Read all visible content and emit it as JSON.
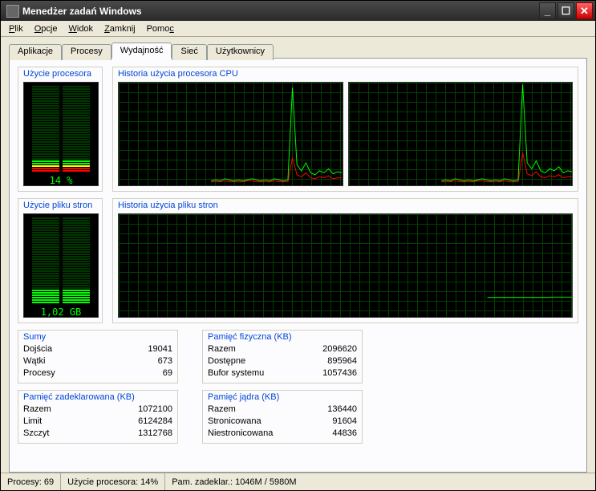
{
  "window": {
    "title": "Menedżer zadań Windows"
  },
  "menu": [
    "Plik",
    "Opcje",
    "Widok",
    "Zamknij",
    "Pomoc"
  ],
  "tabs": [
    {
      "label": "Aplikacje",
      "active": false
    },
    {
      "label": "Procesy",
      "active": false
    },
    {
      "label": "Wydajność",
      "active": true
    },
    {
      "label": "Sieć",
      "active": false
    },
    {
      "label": "Użytkownicy",
      "active": false
    }
  ],
  "cpu_gauge": {
    "title": "Użycie procesora",
    "value": "14 %"
  },
  "cpu_history": {
    "title": "Historia użycia procesora CPU"
  },
  "pf_gauge": {
    "title": "Użycie pliku stron",
    "value": "1,02 GB"
  },
  "pf_history": {
    "title": "Historia użycia pliku stron"
  },
  "stats": {
    "totals": {
      "title": "Sumy",
      "rows": [
        {
          "k": "Dojścia",
          "v": "19041"
        },
        {
          "k": "Wątki",
          "v": "673"
        },
        {
          "k": "Procesy",
          "v": "69"
        }
      ]
    },
    "phys": {
      "title": "Pamięć fizyczna (KB)",
      "rows": [
        {
          "k": "Razem",
          "v": "2096620"
        },
        {
          "k": "Dostępne",
          "v": "895964"
        },
        {
          "k": "Bufor systemu",
          "v": "1057436"
        }
      ]
    },
    "commit": {
      "title": "Pamięć zadeklarowana (KB)",
      "rows": [
        {
          "k": "Razem",
          "v": "1072100"
        },
        {
          "k": "Limit",
          "v": "6124284"
        },
        {
          "k": "Szczyt",
          "v": "1312768"
        }
      ]
    },
    "kernel": {
      "title": "Pamięć jądra (KB)",
      "rows": [
        {
          "k": "Razem",
          "v": "136440"
        },
        {
          "k": "Stronicowana",
          "v": "91604"
        },
        {
          "k": "Niestronicowana",
          "v": "44836"
        }
      ]
    }
  },
  "status": {
    "processes": "Procesy: 69",
    "cpu": "Użycie procesora: 14%",
    "commit": "Pam. zadeklar.: 1046M / 5980M"
  },
  "chart_data": [
    {
      "type": "bar",
      "name": "cpu_gauge",
      "title": "Użycie procesora",
      "values": [
        14
      ],
      "ylim": [
        0,
        100
      ],
      "ylabel": "%",
      "label": "14 %"
    },
    {
      "type": "bar",
      "name": "pagefile_gauge",
      "title": "Użycie pliku stron",
      "values": [
        1.02
      ],
      "ylim": [
        0,
        6
      ],
      "ylabel": "GB",
      "label": "1,02 GB"
    },
    {
      "type": "line",
      "name": "cpu_history",
      "title": "Historia użycia procesora CPU",
      "panels": 2,
      "ylim": [
        0,
        100
      ],
      "xlabel": "time",
      "ylabel": "CPU %",
      "series": [
        {
          "name": "CPU0-user",
          "color": "#00ff00",
          "values": [
            2,
            3,
            2,
            4,
            3,
            2,
            3,
            2,
            3,
            4,
            3,
            2,
            3,
            2,
            4,
            3,
            2,
            3,
            95,
            18,
            12,
            20,
            10,
            8,
            12,
            10,
            14,
            9,
            11,
            10
          ]
        },
        {
          "name": "CPU0-kernel",
          "color": "#ff0000",
          "values": [
            1,
            1,
            1,
            2,
            1,
            1,
            1,
            1,
            2,
            2,
            1,
            1,
            1,
            1,
            2,
            1,
            1,
            1,
            25,
            8,
            6,
            10,
            5,
            4,
            6,
            5,
            7,
            4,
            5,
            5
          ]
        },
        {
          "name": "CPU1-user",
          "color": "#00ff00",
          "values": [
            2,
            3,
            2,
            4,
            3,
            2,
            3,
            2,
            3,
            4,
            3,
            2,
            3,
            2,
            4,
            3,
            2,
            3,
            98,
            20,
            14,
            22,
            12,
            10,
            14,
            12,
            16,
            10,
            12,
            11
          ]
        },
        {
          "name": "CPU1-kernel",
          "color": "#ff0000",
          "values": [
            1,
            1,
            1,
            2,
            1,
            1,
            1,
            1,
            2,
            2,
            1,
            1,
            1,
            1,
            2,
            1,
            1,
            1,
            30,
            9,
            7,
            11,
            6,
            5,
            7,
            6,
            8,
            5,
            6,
            6
          ]
        }
      ]
    },
    {
      "type": "line",
      "name": "pagefile_history",
      "title": "Historia użycia pliku stron",
      "ylim": [
        0,
        6
      ],
      "xlabel": "time",
      "ylabel": "GB",
      "series": [
        {
          "name": "pagefile",
          "color": "#00ff00",
          "values": [
            1.0,
            1.0,
            1.0,
            1.0,
            1.0,
            1.0,
            1.0,
            1.0,
            1.0,
            1.0,
            1.0,
            1.0,
            1.0,
            1.0,
            1.0,
            1.0,
            1.0,
            1.0,
            1.0,
            1.0,
            1.0,
            1.0,
            1.02,
            1.02,
            1.02,
            1.02,
            1.02,
            1.02,
            1.02,
            1.02
          ]
        }
      ]
    }
  ]
}
